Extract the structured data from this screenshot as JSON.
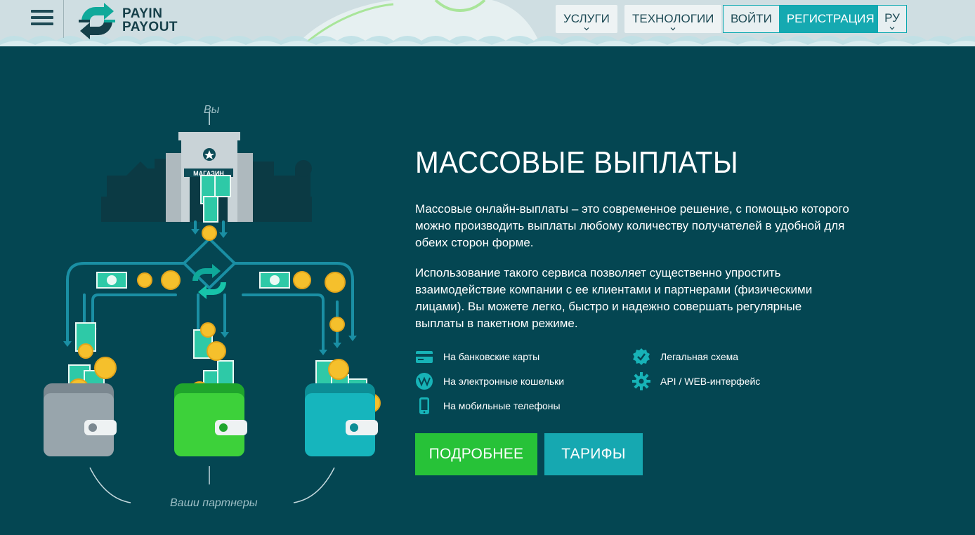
{
  "header": {
    "logo_line1": "PAYIN",
    "logo_line2": "PAYOUT",
    "nav": {
      "services": "УСЛУГИ",
      "technologies": "ТЕХНОЛОГИИ",
      "login": "ВОЙТИ",
      "register": "РЕГИСТРАЦИЯ",
      "language": "РУ"
    }
  },
  "illustration": {
    "top_label": "Вы",
    "shop_sign": "МАГАЗИН",
    "bottom_label": "Ваши партнеры"
  },
  "main": {
    "title": "МАССОВЫЕ ВЫПЛАТЫ",
    "paragraph1": "Массовые онлайн-выплаты – это современное решение, с помощью которого можно производить выплаты любому количеству получателей в удобной для обеих сторон форме.",
    "paragraph2": "Использование такого сервиса позволяет существенно упростить взаимодействие компании с ее клиентами и партнерами (физическими лицами). Вы можете легко, быстро и надежно совершать регулярные выплаты в пакетном режиме.",
    "features": [
      {
        "label": "На банковские карты",
        "icon": "bank-card-icon"
      },
      {
        "label": "На электронные кошельки",
        "icon": "webmoney-icon"
      },
      {
        "label": "На мобильные телефоны",
        "icon": "mobile-phone-icon"
      },
      {
        "label": "Легальная схема",
        "icon": "verified-badge-icon"
      },
      {
        "label": "API / WEB-интерфейс",
        "icon": "gear-icon"
      }
    ],
    "btn_more": "ПОДРОБНЕЕ",
    "btn_tariffs": "ТАРИФЫ"
  },
  "colors": {
    "background": "#044652",
    "header": "#cfdee2",
    "accent_green": "#27c238",
    "accent_teal": "#16a8b1"
  }
}
